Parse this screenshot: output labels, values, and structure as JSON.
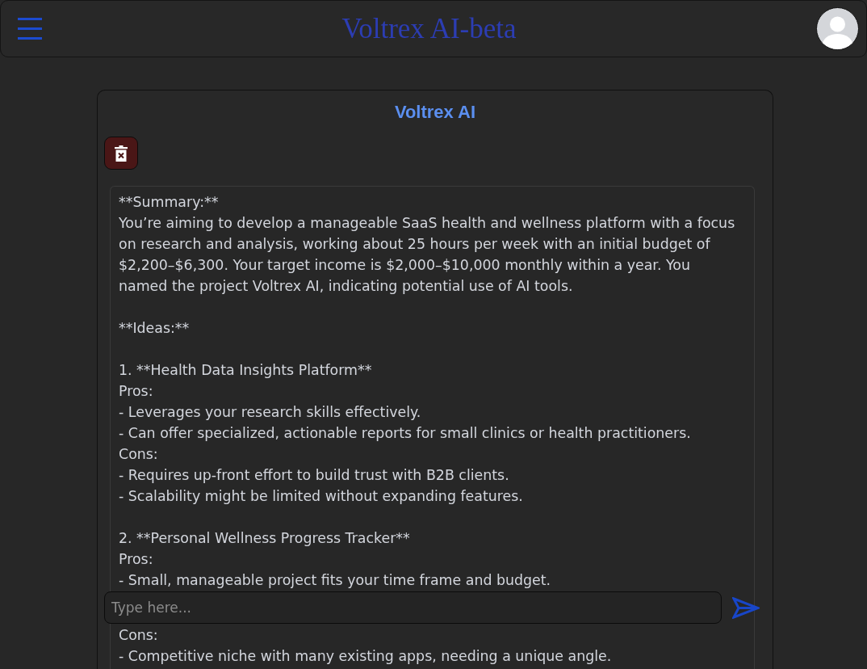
{
  "header": {
    "title": "Voltrex AI-beta"
  },
  "panel": {
    "title": "Voltrex AI"
  },
  "message": {
    "paragraphs": [
      {
        "lines": [
          "**Summary:**",
          "You’re aiming to develop a manageable SaaS health and wellness platform with a focus on research and analysis, working about 25 hours per week with an initial budget of $2,200–$6,300. Your target income is $2,000–$10,000 monthly within a year. You named the project Voltrex AI, indicating potential use of AI tools."
        ]
      },
      {
        "lines": [
          "**Ideas:**"
        ]
      },
      {
        "lines": [
          "1. **Health Data Insights Platform**",
          "Pros:",
          "- Leverages your research skills effectively.",
          "- Can offer specialized, actionable reports for small clinics or health practitioners.",
          "Cons:",
          "- Requires up-front effort to build trust with B2B clients.",
          "- Scalability might be limited without expanding features."
        ]
      },
      {
        "lines": [
          "2. **Personal Wellness Progress Tracker**",
          "Pros:",
          "- Small, manageable project fits your time frame and budget."
        ]
      }
    ]
  },
  "composer": {
    "placeholder": "Type here..."
  },
  "message_below_input": {
    "lines": [
      "Cons:",
      "- Competitive niche with many existing apps, needing a unique angle."
    ]
  }
}
